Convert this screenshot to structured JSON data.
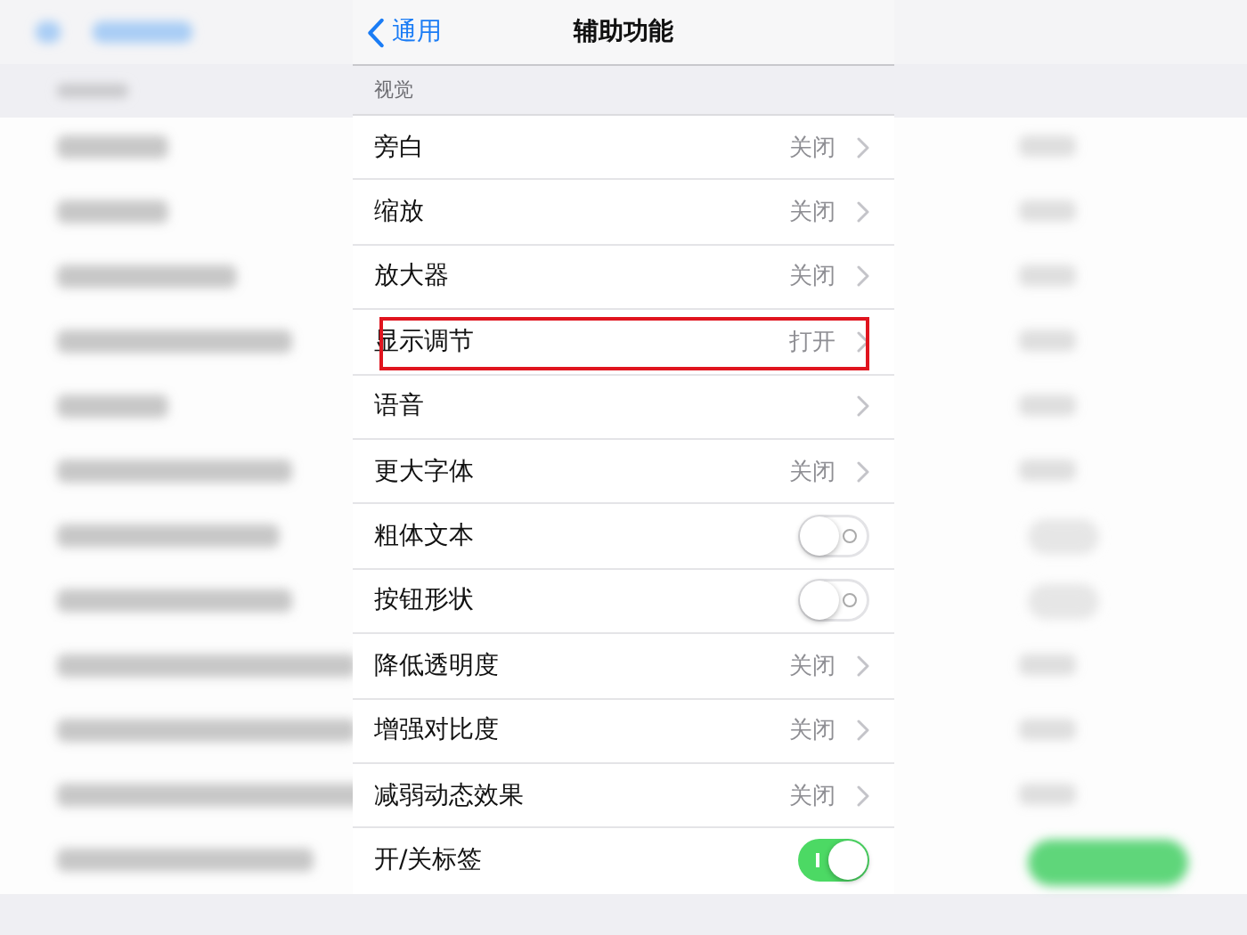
{
  "nav": {
    "back_label": "通用",
    "title": "辅助功能"
  },
  "section_header": "视觉",
  "rows": [
    {
      "kind": "value",
      "label": "旁白",
      "value": "关闭",
      "highlighted": false
    },
    {
      "kind": "value",
      "label": "缩放",
      "value": "关闭",
      "highlighted": false
    },
    {
      "kind": "value",
      "label": "放大器",
      "value": "关闭",
      "highlighted": false
    },
    {
      "kind": "value",
      "label": "显示调节",
      "value": "打开",
      "highlighted": true
    },
    {
      "kind": "link",
      "label": "语音",
      "highlighted": false
    },
    {
      "kind": "value",
      "label": "更大字体",
      "value": "关闭",
      "highlighted": false
    },
    {
      "kind": "toggle",
      "label": "粗体文本",
      "on": false,
      "highlighted": false
    },
    {
      "kind": "toggle",
      "label": "按钮形状",
      "on": false,
      "highlighted": false
    },
    {
      "kind": "value",
      "label": "降低透明度",
      "value": "关闭",
      "highlighted": false
    },
    {
      "kind": "value",
      "label": "增强对比度",
      "value": "关闭",
      "highlighted": false
    },
    {
      "kind": "value",
      "label": "减弱动态效果",
      "value": "关闭",
      "highlighted": false
    },
    {
      "kind": "toggle",
      "label": "开/关标签",
      "on": true,
      "highlighted": false
    }
  ]
}
